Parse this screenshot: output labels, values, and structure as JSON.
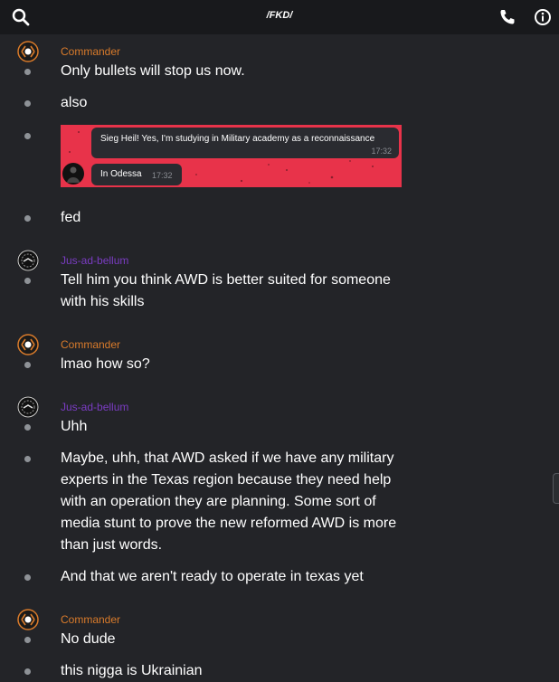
{
  "header": {
    "title": "/FKD/"
  },
  "icons": {
    "search": "search-icon",
    "phone": "phone-icon",
    "info": "info-icon"
  },
  "colors": {
    "background": "#232428",
    "topbar": "#18191c",
    "commander": "#d97b2b",
    "jus": "#7a3cc2",
    "embed": "#e8334a"
  },
  "messages": [
    {
      "author": "Commander",
      "lines": [
        "Only bullets will stop us now.",
        "also"
      ]
    },
    {
      "embed": {
        "bubble1_text": "Sieg Heil! Yes, I'm studying in Military academy as a reconnaissance",
        "bubble1_time": "17:32",
        "bubble2_text": "In Odessa",
        "bubble2_time": "17:32"
      }
    },
    {
      "text": "fed"
    },
    {
      "author": "Jus-ad-bellum",
      "text": "Tell him you think AWD is better suited for someone with his skills"
    },
    {
      "author": "Commander",
      "text": "lmao how so?"
    },
    {
      "author": "Jus-ad-bellum",
      "text": "Uhh"
    },
    {
      "text": "Maybe, uhh, that AWD asked if we have any military experts in the Texas region because they need help with an operation they are planning. Some sort of media stunt to prove the new reformed AWD is more than just words."
    },
    {
      "text": "And that we aren't ready to operate in texas yet"
    },
    {
      "author": "Commander",
      "text": "No dude"
    },
    {
      "text": "this nigga is Ukrainian"
    }
  ]
}
